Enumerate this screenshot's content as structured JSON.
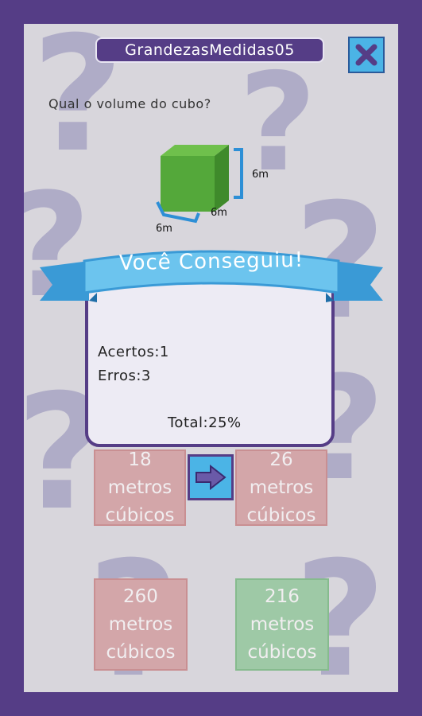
{
  "header": {
    "title": "GrandezasMedidas05",
    "close_icon": "close-x-icon"
  },
  "question": {
    "text": "Qual o volume do cubo?",
    "dimension_labels": [
      "6m",
      "6m",
      "6m"
    ]
  },
  "answers": [
    {
      "label": "18\nmetros\ncúbicos",
      "state": "wrong"
    },
    {
      "label": "26\nmetros\ncúbicos",
      "state": "wrong"
    },
    {
      "label": "260\nmetros\ncúbicos",
      "state": "wrong"
    },
    {
      "label": "216\nmetros\ncúbicos",
      "state": "correct"
    }
  ],
  "result": {
    "banner": "Você Conseguiu!",
    "hits": "Acertos:1",
    "errors": "Erros:3",
    "total": "Total:25%"
  },
  "next_button": {
    "icon": "arrow-right-icon"
  },
  "colors": {
    "frame_purple": "#553d86",
    "accent_blue": "#4bb4e6",
    "cube_green": "#5aa83a",
    "wrong_red": "#d3a6a9",
    "correct_green": "#9ec9a6"
  }
}
